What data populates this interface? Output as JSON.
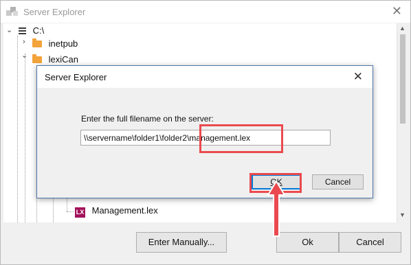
{
  "window": {
    "title": "Server Explorer",
    "close_glyph": "✕"
  },
  "tree": {
    "nodes": [
      {
        "label": "C:\\",
        "type": "drive",
        "expanded": true
      },
      {
        "label": "inetpub",
        "type": "folder",
        "expanded": false
      },
      {
        "label": "lexiCan",
        "type": "folder",
        "expanded": true
      },
      {
        "label": "Management.lex",
        "type": "lex-file",
        "badge": "LX"
      }
    ]
  },
  "buttons": {
    "enter_manually": "Enter Manually...",
    "ok": "Ok",
    "cancel": "Cancel"
  },
  "dialog": {
    "title": "Server Explorer",
    "close_glyph": "✕",
    "prompt": "Enter the full filename on the server:",
    "filename_value": "\\\\servername\\folder1\\folder2\\management.lex",
    "ok_label": "OK",
    "cancel_label": "Cancel"
  },
  "colors": {
    "highlight": "#ea4a4f",
    "folder": "#f2a33a",
    "lex_badge": "#a2125a",
    "dialog_border": "#4d76a8"
  }
}
